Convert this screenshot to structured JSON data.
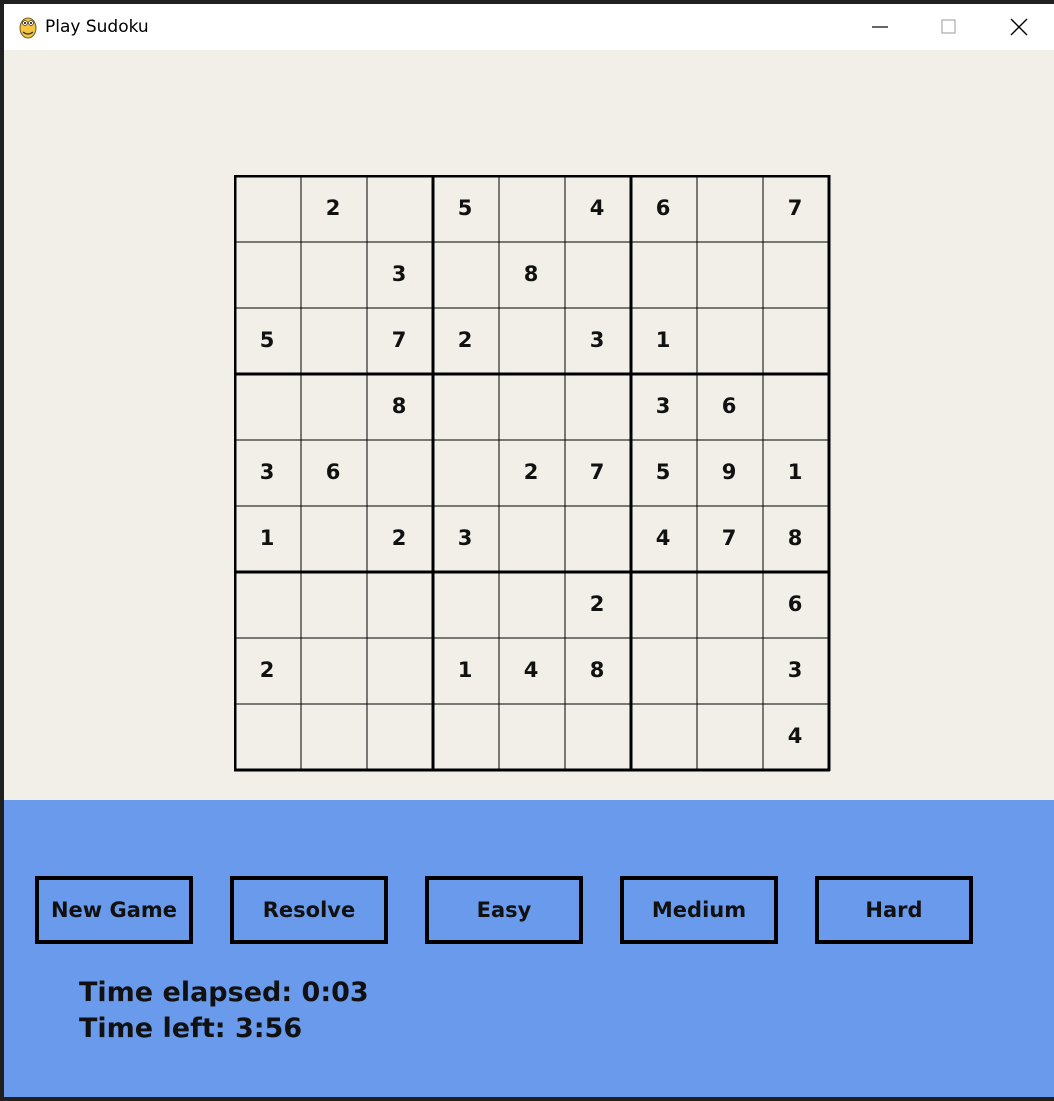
{
  "window": {
    "title": "Play Sudoku"
  },
  "board": [
    [
      null,
      2,
      null,
      5,
      null,
      4,
      6,
      null,
      7
    ],
    [
      null,
      null,
      3,
      null,
      8,
      null,
      null,
      null,
      null
    ],
    [
      5,
      null,
      7,
      2,
      null,
      3,
      1,
      null,
      null
    ],
    [
      null,
      null,
      8,
      null,
      null,
      null,
      3,
      6,
      null
    ],
    [
      3,
      6,
      null,
      null,
      2,
      7,
      5,
      9,
      1
    ],
    [
      1,
      null,
      2,
      3,
      null,
      null,
      4,
      7,
      8
    ],
    [
      null,
      null,
      null,
      null,
      null,
      2,
      null,
      null,
      6
    ],
    [
      2,
      null,
      null,
      1,
      4,
      8,
      null,
      null,
      3
    ],
    [
      null,
      null,
      null,
      null,
      null,
      null,
      null,
      null,
      4
    ]
  ],
  "buttons": {
    "new_game": "New Game",
    "resolve": "Resolve",
    "easy": "Easy",
    "medium": "Medium",
    "hard": "Hard"
  },
  "timer": {
    "elapsed_label": "Time elapsed:",
    "elapsed_value": "0:03",
    "left_label": "Time left:",
    "left_value": "3:56"
  },
  "colors": {
    "board_background": "#f2efe8",
    "panel_background": "#6a9aeb",
    "text": "#111111"
  },
  "icons": {
    "app": "python-logo-icon",
    "minimize": "minimize-icon",
    "maximize": "maximize-icon",
    "close": "close-icon"
  }
}
